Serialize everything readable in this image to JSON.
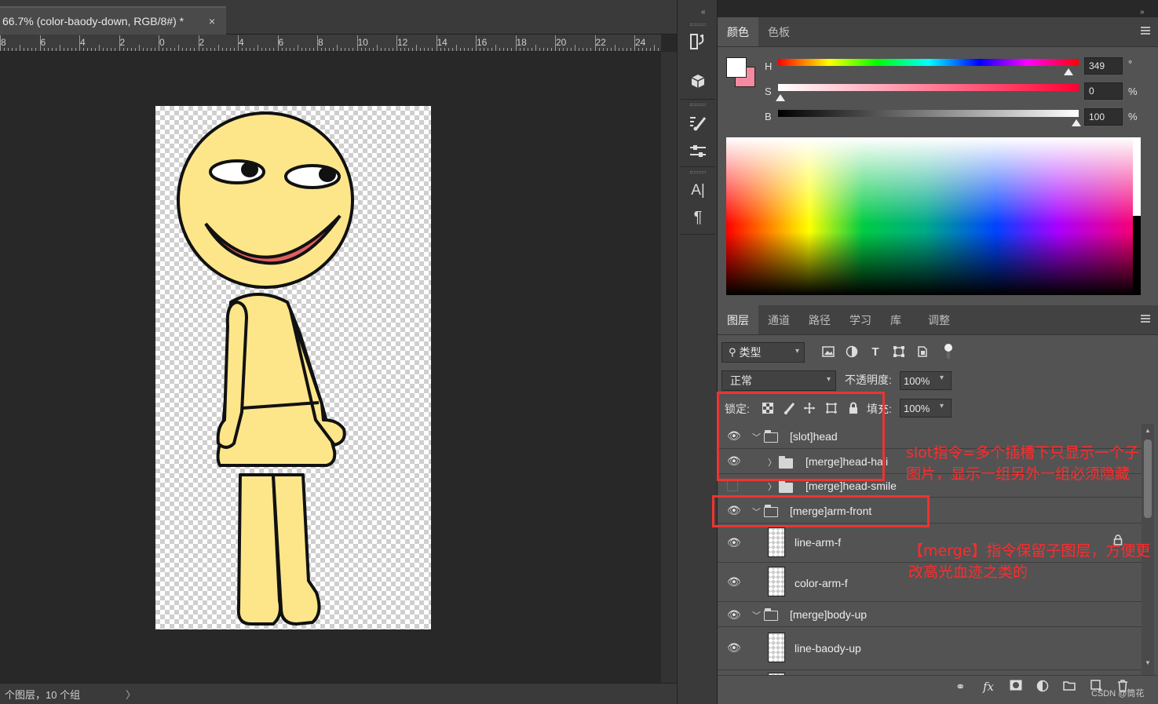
{
  "document": {
    "tab_title": "66.7% (color-baody-down, RGB/8#) *",
    "close_glyph": "×",
    "ruler_labels": [
      "8",
      "6",
      "4",
      "2",
      "0",
      "2",
      "4",
      "6",
      "8",
      "10",
      "12",
      "14",
      "16",
      "18",
      "20",
      "22",
      "24"
    ],
    "status_text": "个图层，10 个组",
    "status_chevron": "〉"
  },
  "color_panel": {
    "tabs": [
      "颜色",
      "色板"
    ],
    "foreground_color": "#ffffff",
    "background_color": "#f38ba0",
    "sliders": [
      {
        "label": "H",
        "value": "349",
        "unit": "°"
      },
      {
        "label": "S",
        "value": "0",
        "unit": "%"
      },
      {
        "label": "B",
        "value": "100",
        "unit": "%"
      }
    ]
  },
  "layers_panel": {
    "tabs": [
      "图层",
      "通道",
      "路径",
      "学习",
      "库",
      "调整"
    ],
    "filter_label": "类型",
    "blend_mode": "正常",
    "opacity_label": "不透明度:",
    "opacity_value": "100%",
    "lock_label": "锁定:",
    "fill_label": "填充:",
    "fill_value": "100%",
    "layers": [
      {
        "name": "[slot]head",
        "type": "group",
        "expanded": true,
        "visible": true,
        "indent": 0
      },
      {
        "name": "[merge]head-haji",
        "type": "group",
        "expanded": false,
        "visible": true,
        "indent": 1
      },
      {
        "name": "[merge]head-smile",
        "type": "group",
        "expanded": false,
        "visible": false,
        "indent": 1
      },
      {
        "name": "[merge]arm-front",
        "type": "group",
        "expanded": true,
        "visible": true,
        "indent": 0
      },
      {
        "name": "line-arm-f",
        "type": "layer",
        "visible": true,
        "locked": true
      },
      {
        "name": "color-arm-f",
        "type": "layer",
        "visible": true
      },
      {
        "name": "[merge]body-up",
        "type": "group",
        "expanded": true,
        "visible": true,
        "indent": 0
      },
      {
        "name": "line-baody-up",
        "type": "layer",
        "visible": true
      }
    ],
    "bottom_icons": [
      "link-icon",
      "fx-icon",
      "mask-icon",
      "adjustment-icon",
      "folder-icon",
      "new-layer-icon",
      "trash-icon"
    ]
  },
  "annotations": {
    "slot_text": "slot指令=多个插槽下只显示一个子图片，显示一组另外一组必须隐藏",
    "merge_text": "【merge】指令保留子图层，方便更改高光血迹之类的",
    "watermark": "CSDN @筒花"
  }
}
